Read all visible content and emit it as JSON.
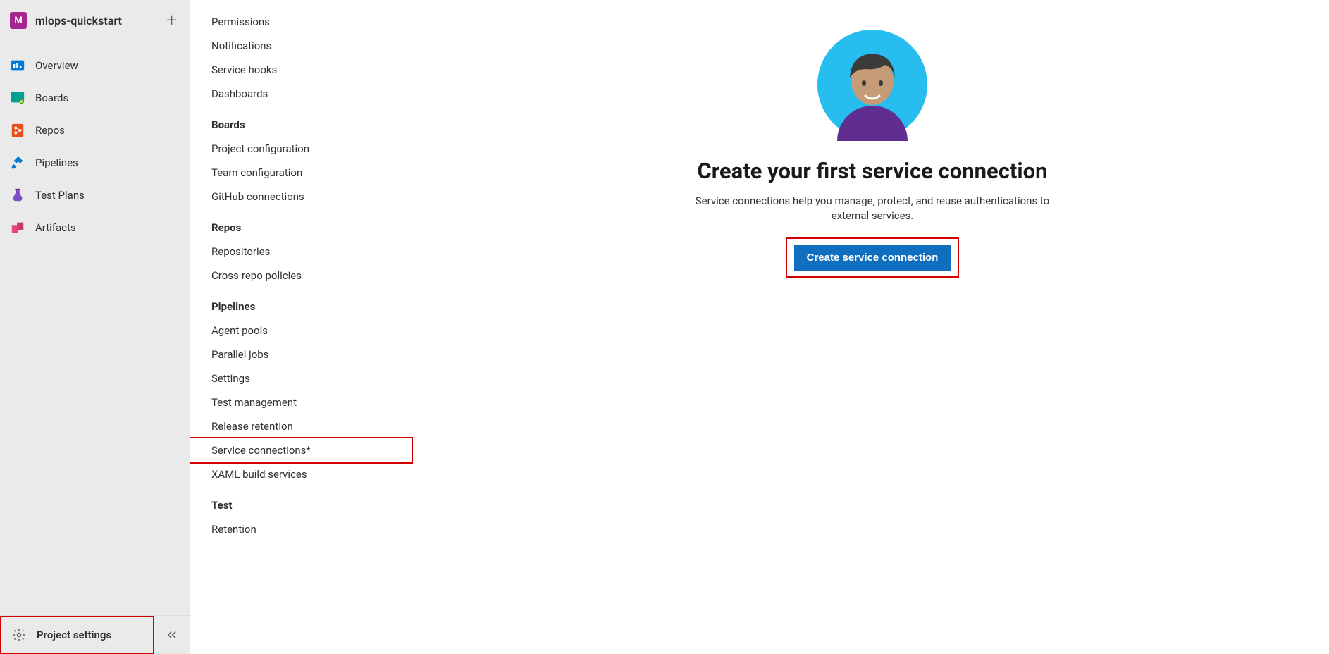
{
  "project": {
    "avatar_letter": "M",
    "name": "mlops-quickstart"
  },
  "sidebar_nav": {
    "overview": "Overview",
    "boards": "Boards",
    "repos": "Repos",
    "pipelines": "Pipelines",
    "test_plans": "Test Plans",
    "artifacts": "Artifacts"
  },
  "sidebar_footer": {
    "project_settings": "Project settings"
  },
  "settings": {
    "general": {
      "permissions": "Permissions",
      "notifications": "Notifications",
      "service_hooks": "Service hooks",
      "dashboards": "Dashboards"
    },
    "boards": {
      "title": "Boards",
      "project_configuration": "Project configuration",
      "team_configuration": "Team configuration",
      "github_connections": "GitHub connections"
    },
    "repos": {
      "title": "Repos",
      "repositories": "Repositories",
      "cross_repo_policies": "Cross-repo policies"
    },
    "pipelines": {
      "title": "Pipelines",
      "agent_pools": "Agent pools",
      "parallel_jobs": "Parallel jobs",
      "settings": "Settings",
      "test_management": "Test management",
      "release_retention": "Release retention",
      "service_connections": "Service connections*",
      "xaml_build_services": "XAML build services"
    },
    "test": {
      "title": "Test",
      "retention": "Retention"
    }
  },
  "main": {
    "title": "Create your first service connection",
    "description": "Service connections help you manage, protect, and reuse authentications to external services.",
    "cta": "Create service connection"
  }
}
